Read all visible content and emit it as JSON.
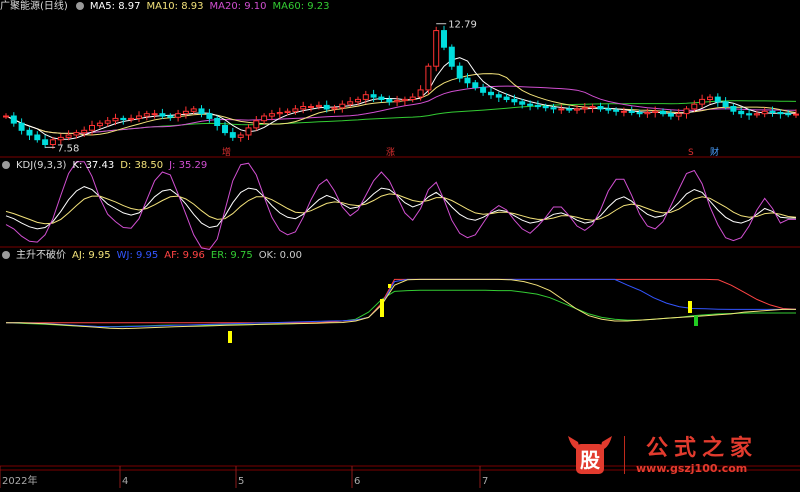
{
  "app": {
    "title": "广聚能源(日线)"
  },
  "headers": {
    "price": [
      {
        "label": "MA5: 8.97",
        "color": "#ffffff"
      },
      {
        "label": "MA10: 8.93",
        "color": "#f3e27a"
      },
      {
        "label": "MA20: 9.10",
        "color": "#d14fd1"
      },
      {
        "label": "MA60: 9.23",
        "color": "#33cc33"
      }
    ],
    "kdj": {
      "name": "KDJ(9,3,3)",
      "values": [
        {
          "label": "K: 37.43",
          "color": "#ffffff"
        },
        {
          "label": "D: 38.50",
          "color": "#f3e27a"
        },
        {
          "label": "J: 35.29",
          "color": "#d14fd1"
        }
      ]
    },
    "indicator": {
      "name": "主升不破价",
      "values": [
        {
          "label": "AJ: 9.95",
          "color": "#f3e27a"
        },
        {
          "label": "WJ: 9.95",
          "color": "#3355ff"
        },
        {
          "label": "AF: 9.96",
          "color": "#ff4444"
        },
        {
          "label": "ER: 9.75",
          "color": "#33cc33"
        },
        {
          "label": "OK: 0.00",
          "color": "#cccccc"
        }
      ]
    }
  },
  "annotations": {
    "high": "12.79",
    "low": "7.58",
    "markers": [
      {
        "text": "增",
        "color": "#e03030"
      },
      {
        "text": "涨",
        "color": "#e03030"
      },
      {
        "text": "S",
        "color": "#e03030"
      },
      {
        "text": "财",
        "color": "#4aa0ff"
      }
    ]
  },
  "watermark": {
    "logo": "股",
    "title": "公式之家",
    "url": "www.gszj100.com"
  },
  "colors": {
    "up": "#ff3333",
    "down": "#00dddd",
    "grid": "#7a0000",
    "axis": "#8a1a1a"
  },
  "chart_data": [
    {
      "type": "candlestick",
      "x_ticks": [
        "2022年",
        "4",
        "5",
        "6",
        "7"
      ],
      "y_range": [
        7.3,
        13.2
      ],
      "labeled_points": [
        {
          "label": "high",
          "value": 12.79
        },
        {
          "label": "low",
          "value": 7.58
        }
      ],
      "close": [
        8.9,
        8.6,
        8.3,
        8.1,
        7.9,
        7.7,
        7.9,
        8.0,
        8.1,
        8.2,
        8.3,
        8.5,
        8.6,
        8.7,
        8.8,
        8.75,
        8.8,
        8.9,
        9.0,
        9.0,
        8.9,
        8.85,
        9.0,
        9.1,
        9.2,
        9.0,
        8.8,
        8.5,
        8.2,
        8.0,
        8.1,
        8.4,
        8.7,
        8.9,
        9.0,
        9.05,
        9.1,
        9.2,
        9.3,
        9.3,
        9.35,
        9.2,
        9.25,
        9.4,
        9.5,
        9.6,
        9.8,
        9.7,
        9.6,
        9.5,
        9.55,
        9.6,
        9.7,
        10.0,
        11.0,
        12.5,
        11.8,
        11.0,
        10.5,
        10.3,
        10.1,
        9.9,
        9.8,
        9.7,
        9.6,
        9.5,
        9.4,
        9.35,
        9.3,
        9.25,
        9.2,
        9.2,
        9.15,
        9.2,
        9.25,
        9.3,
        9.2,
        9.15,
        9.1,
        9.1,
        9.05,
        9.0,
        9.05,
        9.1,
        9.0,
        8.9,
        9.0,
        9.2,
        9.4,
        9.6,
        9.7,
        9.5,
        9.3,
        9.1,
        9.0,
        8.95,
        9.0,
        9.1,
        9.05,
        9.0,
        8.97,
        8.98
      ]
    },
    {
      "type": "line",
      "title": "KDJ(9,3,3)",
      "y_range": [
        0,
        100
      ],
      "series": [
        {
          "name": "K",
          "values": [
            40,
            36,
            30,
            25,
            22,
            24,
            32,
            46,
            62,
            74,
            80,
            76,
            66,
            56,
            50,
            44,
            41,
            44,
            54,
            66,
            74,
            76,
            68,
            56,
            42,
            30,
            24,
            26,
            40,
            58,
            72,
            78,
            76,
            66,
            54,
            44,
            38,
            36,
            42,
            52,
            62,
            68,
            64,
            56,
            50,
            52,
            60,
            70,
            78,
            76,
            68,
            58,
            52,
            56,
            66,
            72,
            64,
            52,
            42,
            36,
            34,
            38,
            44,
            48,
            46,
            40,
            34,
            30,
            32,
            36,
            42,
            44,
            40,
            34,
            30,
            32,
            40,
            52,
            62,
            66,
            60,
            50,
            42,
            38,
            40,
            48,
            58,
            70,
            76,
            72,
            60,
            48,
            38,
            32,
            30,
            34,
            42,
            50,
            46,
            38,
            37,
            37
          ]
        },
        {
          "name": "D",
          "values": [
            46,
            43,
            39,
            35,
            31,
            29,
            30,
            35,
            44,
            54,
            63,
            67,
            67,
            63,
            59,
            54,
            50,
            48,
            50,
            55,
            61,
            66,
            67,
            63,
            56,
            47,
            39,
            35,
            36,
            43,
            53,
            61,
            66,
            66,
            62,
            56,
            50,
            45,
            44,
            47,
            52,
            57,
            59,
            58,
            55,
            54,
            56,
            61,
            67,
            70,
            69,
            65,
            61,
            59,
            61,
            65,
            65,
            61,
            55,
            49,
            44,
            42,
            43,
            45,
            45,
            43,
            40,
            37,
            35,
            35,
            37,
            40,
            40,
            38,
            35,
            34,
            36,
            41,
            48,
            54,
            56,
            54,
            50,
            46,
            44,
            45,
            49,
            56,
            63,
            66,
            64,
            58,
            52,
            45,
            40,
            38,
            39,
            43,
            44,
            42,
            39,
            38
          ]
        },
        {
          "name": "J",
          "values": [
            28,
            22,
            12,
            5,
            4,
            14,
            36,
            68,
            98,
            114,
            114,
            94,
            64,
            42,
            32,
            24,
            23,
            36,
            62,
            88,
            100,
            96,
            70,
            42,
            14,
            -4,
            -6,
            8,
            48,
            88,
            110,
            112,
            96,
            66,
            38,
            20,
            14,
            18,
            38,
            62,
            82,
            90,
            74,
            52,
            40,
            48,
            68,
            88,
            100,
            88,
            66,
            44,
            34,
            50,
            76,
            86,
            62,
            34,
            16,
            10,
            14,
            30,
            46,
            54,
            48,
            34,
            22,
            16,
            26,
            38,
            52,
            52,
            40,
            26,
            20,
            28,
            48,
            74,
            90,
            90,
            68,
            42,
            26,
            22,
            32,
            54,
            76,
            98,
            102,
            84,
            52,
            28,
            10,
            6,
            10,
            26,
            48,
            64,
            50,
            30,
            35,
            35
          ]
        }
      ]
    },
    {
      "type": "line",
      "title": "主升不破价",
      "series": [
        {
          "name": "AJ",
          "values": [
            9.2,
            9.2,
            9.18,
            9.15,
            9.1,
            9.05,
            9.0,
            8.95,
            8.9,
            8.88,
            8.9,
            8.92,
            8.95,
            8.98,
            9.0,
            9.02,
            9.04,
            9.06,
            9.08,
            9.1,
            9.12,
            9.14,
            9.15,
            9.16,
            9.18,
            9.2,
            9.22,
            9.3,
            9.5,
            10.2,
            11.3,
            11.6,
            11.62,
            11.62,
            11.62,
            11.62,
            11.62,
            11.62,
            11.62,
            11.6,
            11.5,
            11.3,
            11.0,
            10.5,
            10.0,
            9.6,
            9.4,
            9.3,
            9.3,
            9.35,
            9.4,
            9.45,
            9.5,
            9.55,
            9.6,
            9.65,
            9.7,
            9.8,
            9.85,
            9.9,
            9.95,
            9.95
          ]
        },
        {
          "name": "WJ",
          "values": [
            9.2,
            9.2,
            9.18,
            9.16,
            9.12,
            9.08,
            9.04,
            9.0,
            8.98,
            8.98,
            9.0,
            9.02,
            9.04,
            9.06,
            9.08,
            9.1,
            9.12,
            9.14,
            9.16,
            9.18,
            9.2,
            9.22,
            9.24,
            9.26,
            9.28,
            9.3,
            9.32,
            9.36,
            9.5,
            10.2,
            11.5,
            11.62,
            11.62,
            11.62,
            11.62,
            11.62,
            11.62,
            11.62,
            11.62,
            11.62,
            11.62,
            11.62,
            11.62,
            11.62,
            11.62,
            11.62,
            11.62,
            11.62,
            11.3,
            11.0,
            10.6,
            10.3,
            10.1,
            10.0,
            9.98,
            9.96,
            9.95,
            9.95,
            9.95,
            9.95,
            9.95,
            9.95
          ]
        },
        {
          "name": "AF",
          "values": [
            9.2,
            9.2,
            9.2,
            9.2,
            9.2,
            9.2,
            9.2,
            9.2,
            9.2,
            9.2,
            9.2,
            9.2,
            9.2,
            9.2,
            9.2,
            9.2,
            9.2,
            9.2,
            9.2,
            9.2,
            9.2,
            9.2,
            9.2,
            9.2,
            9.2,
            9.25,
            9.3,
            9.35,
            9.5,
            10.3,
            11.62,
            11.62,
            11.62,
            11.62,
            11.62,
            11.62,
            11.62,
            11.62,
            11.62,
            11.62,
            11.62,
            11.62,
            11.62,
            11.62,
            11.62,
            11.62,
            11.62,
            11.62,
            11.62,
            11.62,
            11.62,
            11.62,
            11.62,
            11.62,
            11.62,
            11.6,
            11.3,
            10.9,
            10.5,
            10.2,
            10.0,
            9.96
          ]
        },
        {
          "name": "ER",
          "values": [
            9.2,
            9.18,
            9.15,
            9.12,
            9.08,
            9.04,
            9.0,
            8.98,
            8.98,
            9.0,
            9.02,
            9.04,
            9.06,
            9.08,
            9.08,
            9.08,
            9.08,
            9.1,
            9.1,
            9.1,
            9.12,
            9.12,
            9.15,
            9.18,
            9.2,
            9.25,
            9.3,
            9.4,
            9.8,
            10.5,
            10.95,
            11.0,
            11.02,
            11.02,
            11.02,
            11.02,
            11.02,
            11.02,
            11.0,
            11.0,
            10.9,
            10.8,
            10.6,
            10.3,
            10.0,
            9.7,
            9.5,
            9.4,
            9.35,
            9.35,
            9.4,
            9.45,
            9.5,
            9.6,
            9.65,
            9.7,
            9.72,
            9.74,
            9.75,
            9.75,
            9.75,
            9.75
          ]
        }
      ]
    }
  ]
}
